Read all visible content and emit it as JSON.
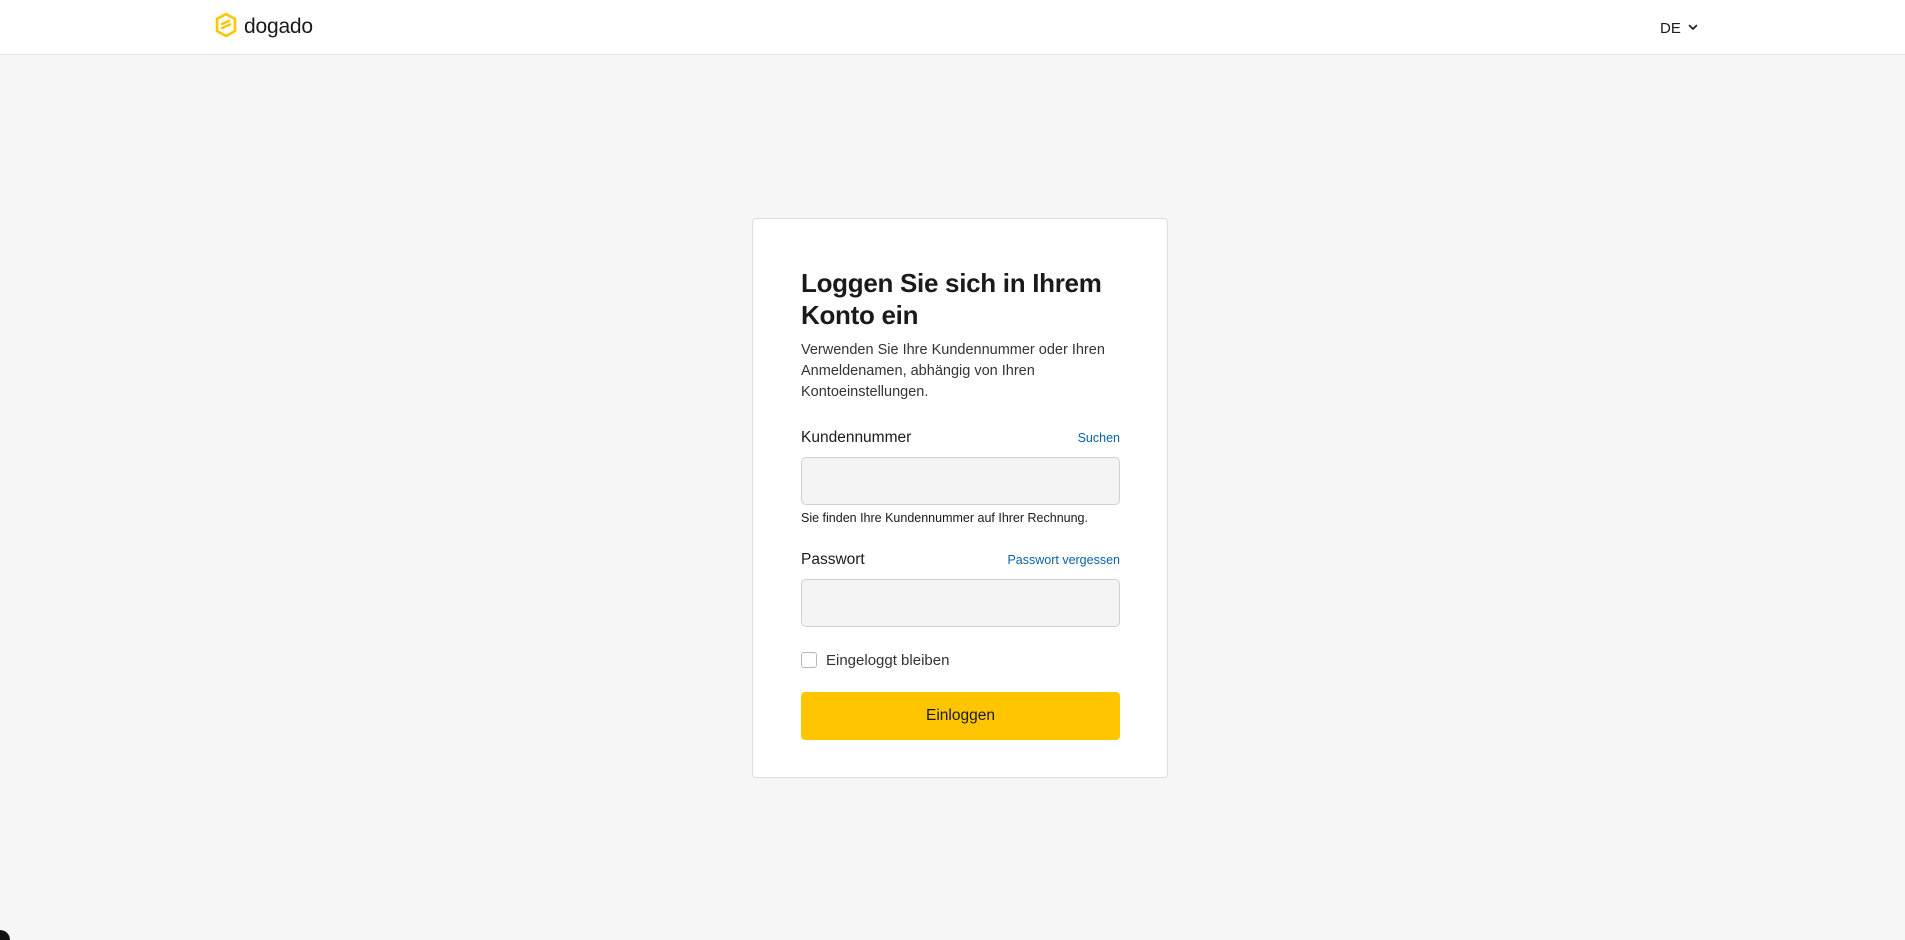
{
  "header": {
    "logo_text": "dogado",
    "language": "DE"
  },
  "login": {
    "title": "Loggen Sie sich in Ihrem Konto ein",
    "subtitle": "Verwenden Sie Ihre Kundennummer oder Ihren Anmeldenamen, abhängig von Ihren Kontoeinstellungen.",
    "customer_number": {
      "label": "Kundennummer",
      "link": "Suchen",
      "value": "",
      "hint": "Sie finden Ihre Kundennummer auf Ihrer Rechnung."
    },
    "password": {
      "label": "Passwort",
      "link": "Passwort vergessen",
      "value": ""
    },
    "remember_label": "Eingeloggt bleiben",
    "remember_checked": false,
    "submit_label": "Einloggen"
  },
  "colors": {
    "accent": "#ffc600",
    "link": "#0b61a4",
    "background": "#f6f6f6"
  },
  "icons": {
    "logo": "dogado-logo-icon",
    "language_chevron": "chevron-down-icon"
  }
}
